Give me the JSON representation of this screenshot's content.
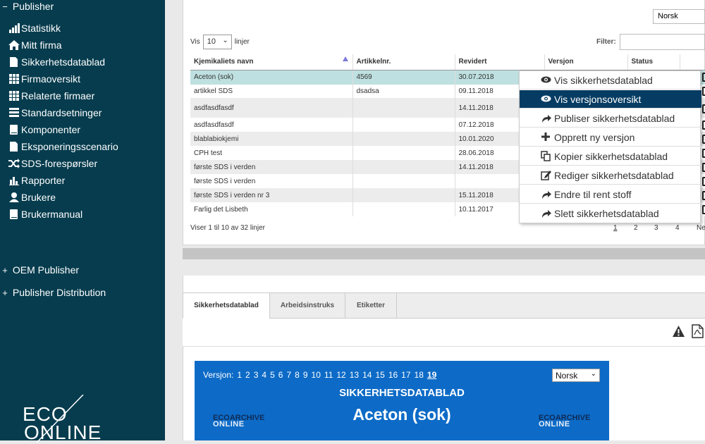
{
  "sidebar": {
    "section_main": "Publisher",
    "items": [
      {
        "label": "Statistikk",
        "icon": "bar-chart-icon"
      },
      {
        "label": "Mitt firma",
        "icon": "home-icon"
      },
      {
        "label": "Sikkerhetsdatablad",
        "icon": "document-icon"
      },
      {
        "label": "Firmaoversikt",
        "icon": "grid-icon"
      },
      {
        "label": "Relaterte firmaer",
        "icon": "grid-icon"
      },
      {
        "label": "Standardsetninger",
        "icon": "list-icon"
      },
      {
        "label": "Komponenter",
        "icon": "book-icon"
      },
      {
        "label": "Eksponeringsscenario",
        "icon": "document-icon"
      },
      {
        "label": "SDS-forespørsler",
        "icon": "shuffle-icon"
      },
      {
        "label": "Rapporter",
        "icon": "bar-chart-icon"
      },
      {
        "label": "Brukere",
        "icon": "user-icon"
      },
      {
        "label": "Brukermanual",
        "icon": "book-icon"
      }
    ],
    "section_oem": "OEM Publisher",
    "section_dist": "Publisher Distribution",
    "logo_top": "ECO",
    "logo_bottom": "ONLINE"
  },
  "top": {
    "language": "Norsk",
    "vis_label": "Vis",
    "vis_value": "10",
    "linjer_label": "linjer",
    "filter_label": "Filter:",
    "columns": [
      "Kjemikaliets navn",
      "Artikkelnr.",
      "Revidert",
      "Versjon",
      "Status"
    ],
    "rows": [
      {
        "name": "Aceton (sok)",
        "art": "4569",
        "rev": "30.07.2018"
      },
      {
        "name": "artikkel SDS",
        "art": "dsadsa",
        "rev": "09.11.2018"
      },
      {
        "name": "asdfasdfasdf",
        "art": "",
        "rev": "14.11.2018"
      },
      {
        "name": "asdfasdfasdf",
        "art": "",
        "rev": "07.12.2018"
      },
      {
        "name": "blablabiokjemi",
        "art": "",
        "rev": "10.01.2020"
      },
      {
        "name": "CPH test",
        "art": "",
        "rev": "28.06.2018"
      },
      {
        "name": "første SDS i verden",
        "art": "",
        "rev": "14.11.2018"
      },
      {
        "name": "første SDS i verden",
        "art": "",
        "rev": ""
      },
      {
        "name": "første SDS i verden nr 3",
        "art": "",
        "rev": "15.11.2018"
      },
      {
        "name": "Farlig det Lisbeth",
        "art": "",
        "rev": "10.11.2017"
      }
    ],
    "info": "Viser 1 til 10 av 32 linjer",
    "pages": [
      "1",
      "2",
      "3",
      "4",
      "Ne"
    ]
  },
  "menu": {
    "items": [
      {
        "label": "Vis sikkerhetsdatablad",
        "icon": "eye-icon"
      },
      {
        "label": "Vis versjonsoversikt",
        "icon": "eye-icon"
      },
      {
        "label": "Publiser sikkerhetsdatablad",
        "icon": "share-icon"
      },
      {
        "label": "Opprett ny versjon",
        "icon": "plus-icon"
      },
      {
        "label": "Kopier sikkerhetsdatablad",
        "icon": "copy-icon"
      },
      {
        "label": "Rediger sikkerhetsdatablad",
        "icon": "edit-icon"
      },
      {
        "label": "Endre til rent stoff",
        "icon": "share-icon"
      },
      {
        "label": "Slett sikkerhetsdatablad",
        "icon": "share-icon"
      }
    ]
  },
  "tabs": [
    "Sikkerhetsdatablad",
    "Arbeidsinstruks",
    "Etiketter"
  ],
  "sds": {
    "version_label": "Versjon:",
    "versions": [
      "1",
      "2",
      "3",
      "4",
      "5",
      "6",
      "7",
      "8",
      "9",
      "10",
      "11",
      "12",
      "13",
      "14",
      "15",
      "16",
      "17",
      "18",
      "19"
    ],
    "language": "Norsk",
    "title": "SIKKERHETSDATABLAD",
    "name": "Aceton (sok)",
    "ea_top": "ECOARCHIVE",
    "ea_bottom": "ONLINE"
  },
  "colors": {
    "sidebar": "#063c4e",
    "active_menu": "#063c63",
    "selected_row": "#bfe0e0",
    "sds_blue": "#0d6bc7"
  }
}
